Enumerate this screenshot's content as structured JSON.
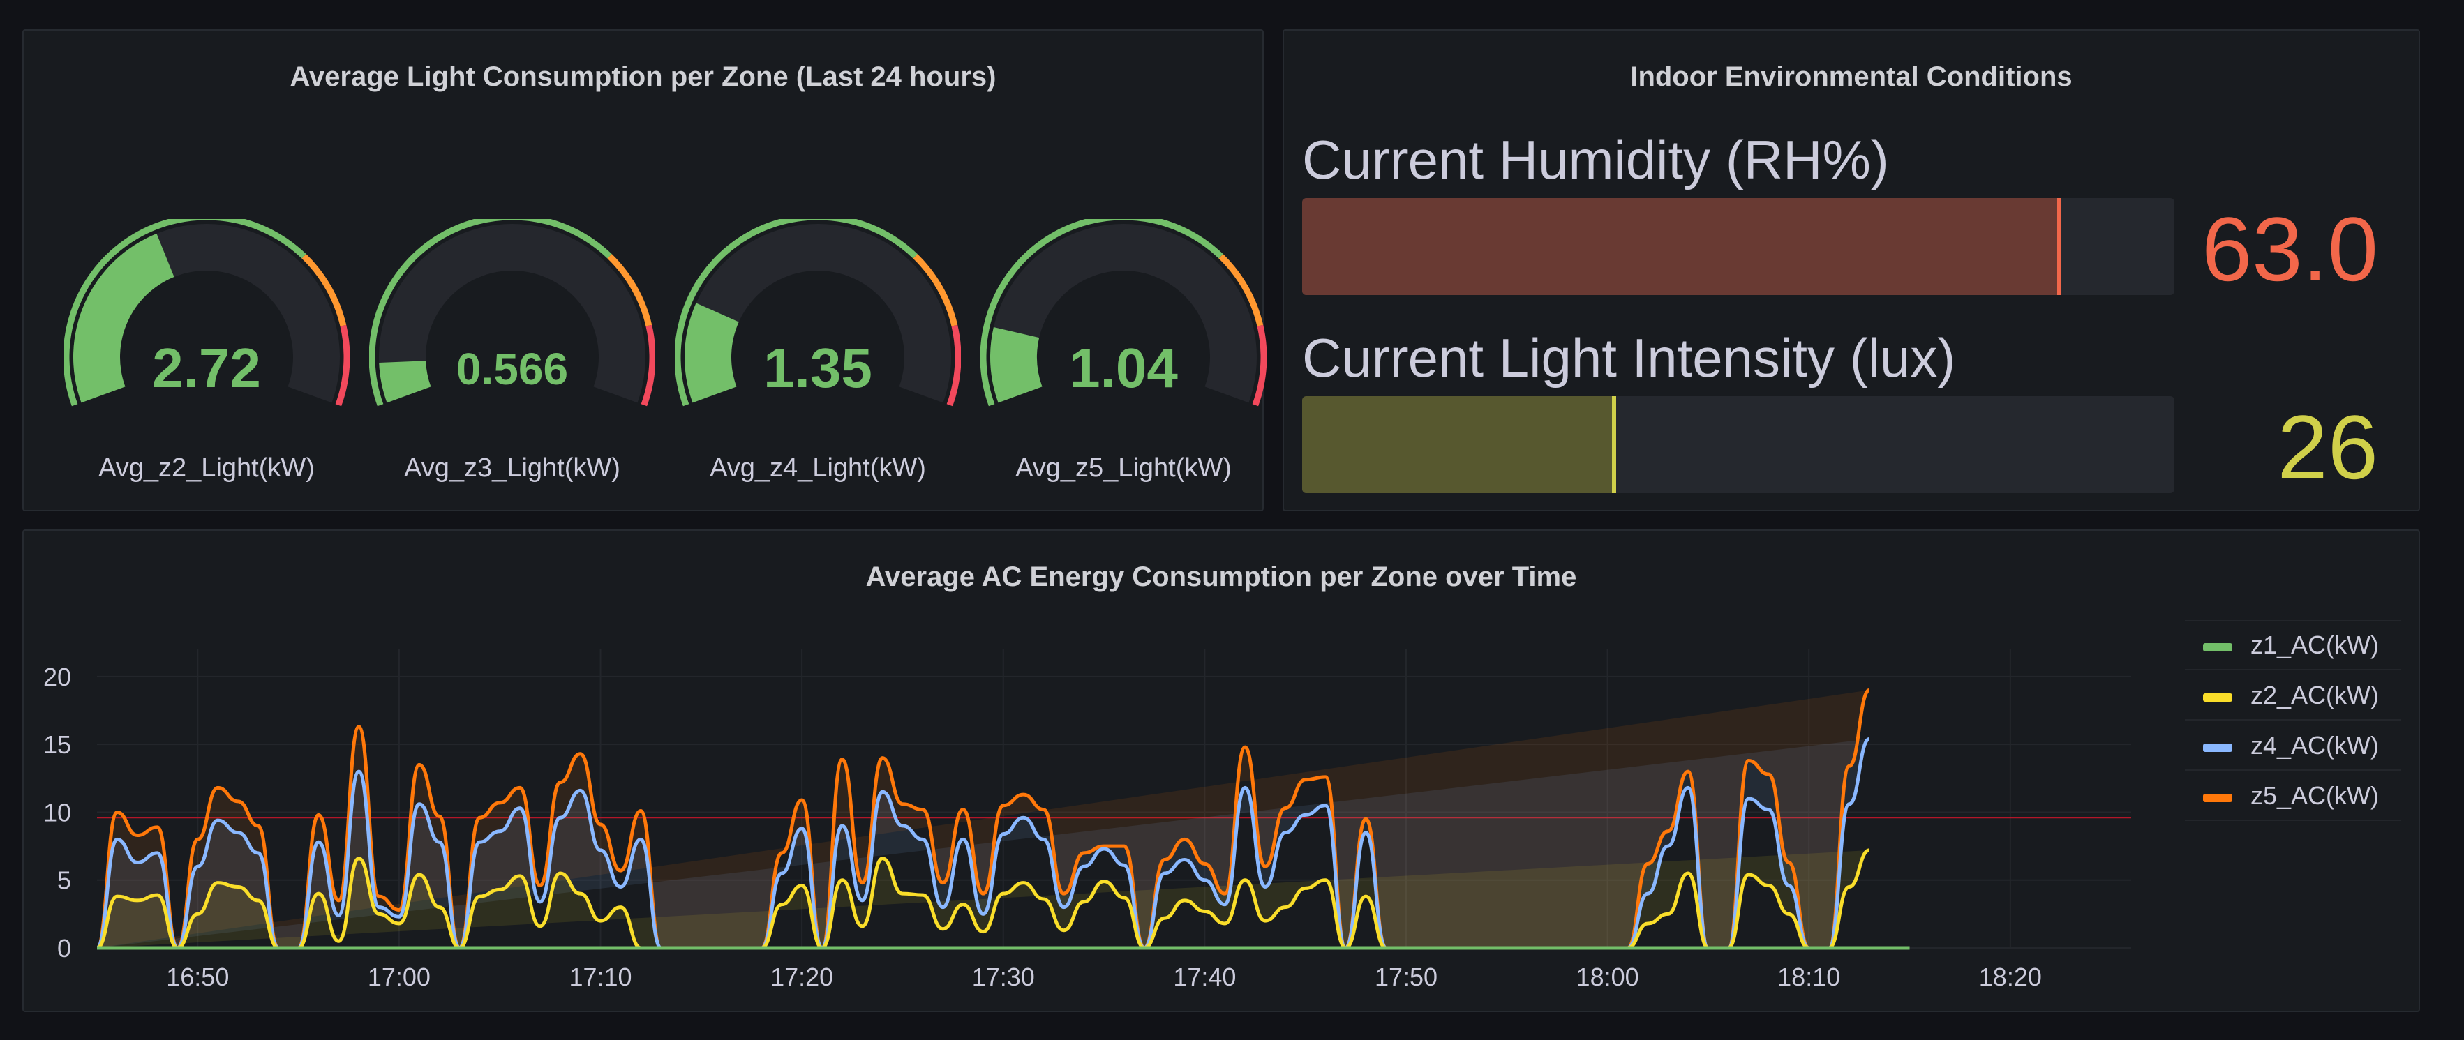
{
  "light_panel": {
    "title": "Average Light Consumption per Zone (Last 24 hours)",
    "gauges": [
      {
        "label": "Avg_z2_Light(kW)",
        "value": "2.72",
        "fraction": 0.4
      },
      {
        "label": "Avg_z3_Light(kW)",
        "value": "0.566",
        "fraction": 0.08
      },
      {
        "label": "Avg_z4_Light(kW)",
        "value": "1.35",
        "fraction": 0.2
      },
      {
        "label": "Avg_z5_Light(kW)",
        "value": "1.04",
        "fraction": 0.15
      }
    ]
  },
  "env_panel": {
    "title": "Indoor Environmental Conditions",
    "humidity": {
      "label": "Current Humidity (RH%)",
      "value": "63.0",
      "fraction": 0.87,
      "color": "#f2674a"
    },
    "light": {
      "label": "Current Light Intensity (lux)",
      "value": "26",
      "fraction": 0.36,
      "color": "#d0d04a"
    }
  },
  "ac_panel": {
    "title": "Average AC Energy Consumption per Zone over Time",
    "legend": [
      {
        "label": "z1_AC(kW)",
        "color": "#73bf69"
      },
      {
        "label": "z2_AC(kW)",
        "color": "#fade2a"
      },
      {
        "label": "z4_AC(kW)",
        "color": "#8ab8ff"
      },
      {
        "label": "z5_AC(kW)",
        "color": "#ff780a"
      }
    ]
  },
  "chart_data": {
    "type": "area",
    "threshold": 9.6,
    "ylim": [
      0,
      22
    ],
    "yticks": [
      "0",
      "5",
      "10",
      "15",
      "20"
    ],
    "xlim": [
      "16:45",
      "18:26"
    ],
    "xticks": [
      "16:50",
      "17:00",
      "17:10",
      "17:20",
      "17:30",
      "17:40",
      "17:50",
      "18:00",
      "18:10",
      "18:20"
    ],
    "x": [
      "16:45",
      "16:46",
      "16:47",
      "16:48",
      "16:49",
      "16:50",
      "16:51",
      "16:52",
      "16:53",
      "16:54",
      "16:55",
      "16:56",
      "16:57",
      "16:58",
      "16:59",
      "17:00",
      "17:01",
      "17:02",
      "17:03",
      "17:04",
      "17:05",
      "17:06",
      "17:07",
      "17:08",
      "17:09",
      "17:10",
      "17:11",
      "17:12",
      "17:13",
      "17:14",
      "17:15",
      "17:16",
      "17:17",
      "17:18",
      "17:19",
      "17:20",
      "17:21",
      "17:22",
      "17:23",
      "17:24",
      "17:25",
      "17:26",
      "17:27",
      "17:28",
      "17:29",
      "17:30",
      "17:31",
      "17:32",
      "17:33",
      "17:34",
      "17:35",
      "17:36",
      "17:37",
      "17:38",
      "17:39",
      "17:40",
      "17:41",
      "17:42",
      "17:43",
      "17:44",
      "17:45",
      "17:46",
      "17:47",
      "17:48",
      "17:49",
      "17:50",
      "17:51",
      "17:52",
      "17:53",
      "17:54",
      "17:55",
      "17:56",
      "17:57",
      "17:58",
      "17:59",
      "18:00",
      "18:01",
      "18:02",
      "18:03",
      "18:04",
      "18:05",
      "18:06",
      "18:07",
      "18:08",
      "18:09",
      "18:10",
      "18:11",
      "18:12",
      "18:13",
      "18:14",
      "18:15"
    ],
    "series": [
      {
        "name": "z1_AC(kW)",
        "values": [
          0,
          0,
          0,
          0,
          0,
          0,
          0,
          0,
          0,
          0,
          0,
          0,
          0,
          0,
          0,
          0,
          0,
          0,
          0,
          0,
          0,
          0,
          0,
          0,
          0,
          0,
          0,
          0,
          0,
          0,
          0,
          0,
          0,
          0,
          0,
          0,
          0,
          0,
          0,
          0,
          0,
          0,
          0,
          0,
          0,
          0,
          0,
          0,
          0,
          0,
          0,
          0,
          0,
          0,
          0,
          0,
          0,
          0,
          0,
          0,
          0,
          0,
          0,
          0,
          0,
          0,
          0,
          0,
          0,
          0,
          0,
          0,
          0,
          0,
          0,
          0,
          0,
          0,
          0,
          0,
          0,
          0,
          0,
          0,
          0,
          0,
          0,
          0,
          0,
          0,
          0
        ]
      },
      {
        "name": "z2_AC(kW)",
        "values": [
          0,
          3.8,
          3.5,
          3.9,
          0,
          2.5,
          4.8,
          4.5,
          3.5,
          0,
          0,
          4,
          0.5,
          6.6,
          2.5,
          1.8,
          5.4,
          3,
          0,
          3.8,
          4.3,
          5.3,
          1.6,
          5.5,
          4,
          2,
          3,
          0,
          0,
          0,
          0,
          0,
          0,
          0,
          3.2,
          4.6,
          0,
          5,
          1.6,
          6.6,
          4,
          3.9,
          1.4,
          3.2,
          1.2,
          4,
          4.8,
          3.6,
          1.3,
          3.4,
          4.9,
          3.7,
          0,
          2.2,
          3.5,
          2.7,
          1.8,
          5,
          2,
          3,
          4.4,
          5,
          0,
          3.8,
          0,
          0,
          0,
          0,
          0,
          0,
          0,
          0,
          0,
          0,
          0,
          0,
          0,
          1.8,
          2.5,
          5.5,
          0,
          0,
          5.4,
          4.6,
          2.5,
          0,
          0,
          4.5,
          7.2
        ]
      },
      {
        "name": "z4_AC(kW)",
        "values": [
          0,
          8,
          6.3,
          7,
          0,
          6,
          9.4,
          8.5,
          7,
          0,
          0,
          7.8,
          2.4,
          13,
          3,
          2.3,
          10.6,
          7.8,
          0,
          7.8,
          8.6,
          10.3,
          3.4,
          9.6,
          11.6,
          7.2,
          4.5,
          8,
          0,
          0,
          0,
          0,
          0,
          0,
          5.5,
          8.8,
          0,
          9,
          3.5,
          11.5,
          9,
          8,
          3,
          8,
          2.5,
          8.4,
          9.6,
          8,
          3,
          6,
          7.3,
          6.1,
          0,
          5.5,
          6.5,
          5,
          3.2,
          11.8,
          4.5,
          8.5,
          9.8,
          10.5,
          0,
          8.5,
          0,
          0,
          0,
          0,
          0,
          0,
          0,
          0,
          0,
          0,
          0,
          0,
          0,
          4,
          7.5,
          11.8,
          0,
          0,
          11,
          10.2,
          4.6,
          0,
          0,
          10.6,
          15.4
        ]
      },
      {
        "name": "z5_AC(kW)",
        "values": [
          0,
          10,
          8.3,
          8.9,
          0,
          8,
          11.8,
          10.8,
          9,
          0,
          0,
          9.8,
          3.5,
          16.3,
          3.8,
          2.8,
          13.5,
          9.7,
          0,
          9.6,
          10.7,
          11.8,
          4.6,
          12.2,
          14.3,
          9.1,
          5.7,
          10.1,
          0,
          0,
          0,
          0,
          0,
          0,
          7,
          10.9,
          0,
          13.9,
          4.8,
          14,
          10.6,
          10.2,
          4.8,
          10.2,
          4,
          10.5,
          11.3,
          10.2,
          4,
          7,
          7.5,
          7.5,
          0,
          6.5,
          8,
          6.2,
          4,
          14.8,
          6,
          10.3,
          12.4,
          12.6,
          0,
          9.5,
          0,
          0,
          0,
          0,
          0,
          0,
          0,
          0,
          0,
          0,
          0,
          0,
          0,
          6.2,
          8.6,
          13,
          0,
          0,
          13.8,
          12.8,
          6.3,
          0,
          0,
          13.4,
          19
        ]
      }
    ]
  }
}
